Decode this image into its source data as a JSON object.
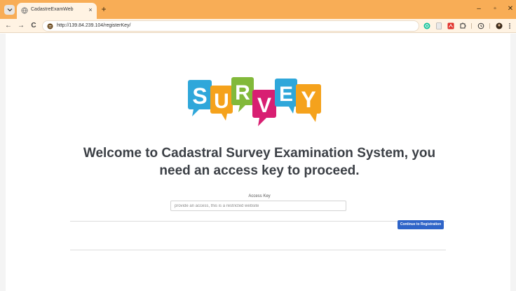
{
  "browser": {
    "tab_title": "CadastreExamWeb",
    "tab_close": "×",
    "new_tab": "+",
    "url": "http://139.84.239.104/registerKey/",
    "nav": {
      "back": "←",
      "forward": "→",
      "reload": "C"
    },
    "window_controls": {
      "minimize": "–",
      "maximize": "▫",
      "close": "✕"
    },
    "extension_icons": [
      "grammarly-icon",
      "page-icon",
      "pdf-icon",
      "puzzle-icon",
      "history-icon",
      "profile-icon",
      "menu-icon"
    ],
    "colors": {
      "tabstrip": "#f8ad56",
      "toolbar": "#fff3e3"
    }
  },
  "logo": {
    "letters": [
      "S",
      "U",
      "R",
      "V",
      "E",
      "Y"
    ],
    "colors": [
      "#2fa7da",
      "#f5a21c",
      "#82b93a",
      "#d81f72",
      "#2fa7da",
      "#f5a21c"
    ]
  },
  "page": {
    "heading_line1": "Welcome to Cadastral Survey Examination System, you",
    "heading_line2": "need an access key to proceed.",
    "field_label": "Access Key",
    "input_placeholder": "provide an access, this is a restricted website",
    "input_value": "",
    "submit_label": "Continue to Registration",
    "accent_color": "#2e64c8"
  }
}
